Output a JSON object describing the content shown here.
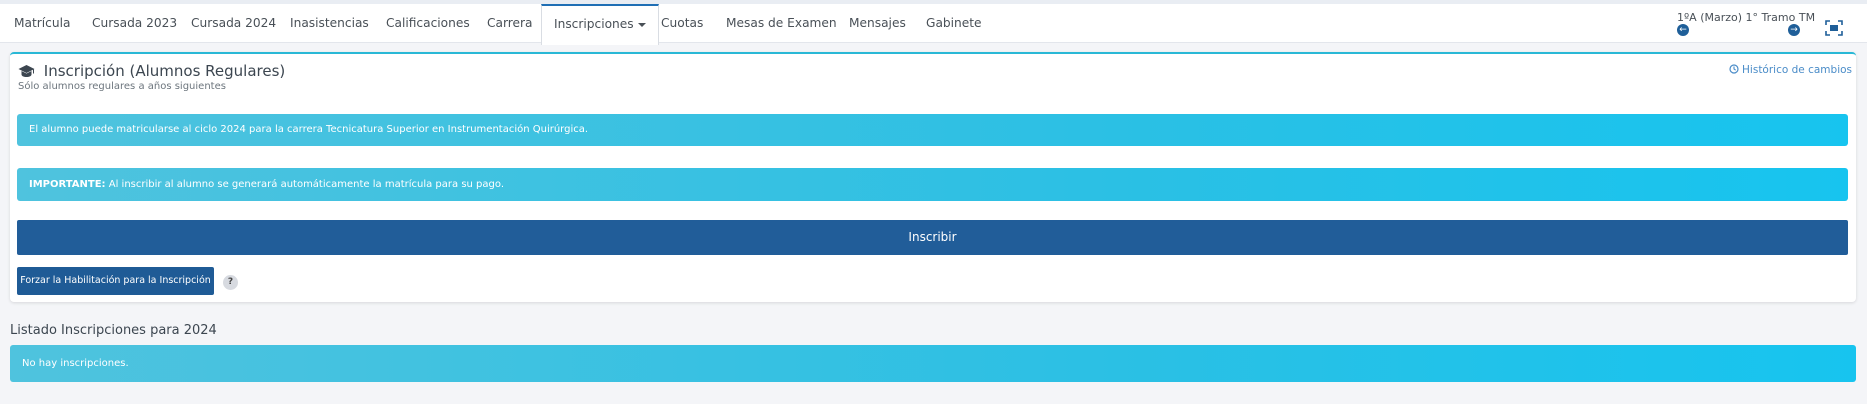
{
  "tabs": [
    {
      "label": "Matrícula"
    },
    {
      "label": "Cursada 2023"
    },
    {
      "label": "Cursada 2024"
    },
    {
      "label": "Inasistencias"
    },
    {
      "label": "Calificaciones"
    },
    {
      "label": "Carrera"
    },
    {
      "label": "Inscripciones",
      "active": true,
      "dropdown": true
    },
    {
      "label": "Cuotas"
    },
    {
      "label": "Mesas de Examen"
    },
    {
      "label": "Mensajes"
    },
    {
      "label": "Gabinete"
    }
  ],
  "period": {
    "label": "1ºA (Marzo) 1° Tramo TM",
    "prev_icon": "arrow-left-circle-icon",
    "next_icon": "arrow-right-circle-icon"
  },
  "scan_icon": "scan-icon",
  "inscription": {
    "title": "Inscripción (Alumnos Regulares)",
    "title_icon": "graduation-cap-icon",
    "subtitle": "Sólo alumnos regulares a años siguientes",
    "history_link": "Histórico de cambios",
    "history_icon": "history-icon",
    "eligibility_message": "El alumno puede matricularse al ciclo 2024 para la carrera Tecnicatura Superior en Instrumentación Quirúrgica.",
    "important_label": "IMPORTANTE:",
    "important_message": " Al inscribir al alumno se generará automáticamente la matrícula para su pago.",
    "enroll_button": "Inscribir",
    "force_button": "Forzar la Habilitación para la Inscripción",
    "help_label": "?"
  },
  "listing": {
    "title": "Listado Inscripciones para 2024",
    "empty_message": "No hay inscripciones."
  },
  "colors": {
    "primary": "#215d99",
    "info": "#2bc0e4",
    "accent_border": "#29b8d6"
  }
}
